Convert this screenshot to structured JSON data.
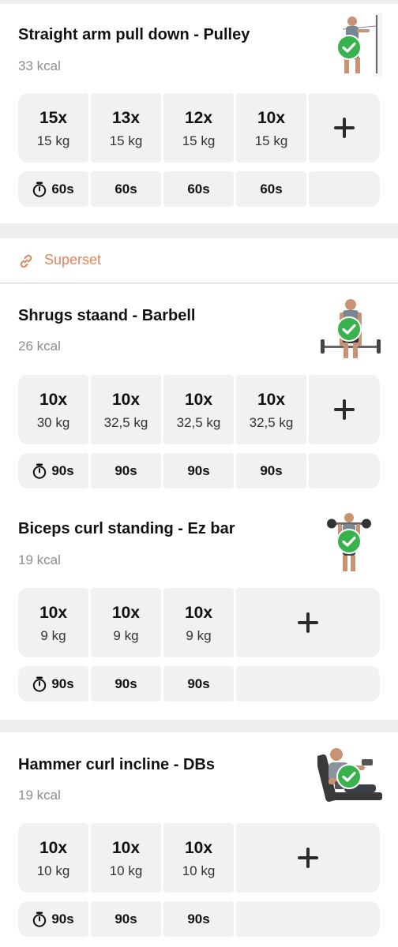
{
  "superset": {
    "label": "Superset",
    "icon": "link-icon",
    "color": "#e88258"
  },
  "exercises": [
    {
      "title": "Straight arm pull down - Pulley",
      "kcal": "33 kcal",
      "completed": true,
      "sets": [
        {
          "reps": "15x",
          "weight": "15 kg"
        },
        {
          "reps": "13x",
          "weight": "15 kg"
        },
        {
          "reps": "12x",
          "weight": "15 kg"
        },
        {
          "reps": "10x",
          "weight": "15 kg"
        }
      ],
      "rests": [
        "60s",
        "60s",
        "60s",
        "60s"
      ]
    },
    {
      "title": "Shrugs staand - Barbell",
      "kcal": "26 kcal",
      "completed": true,
      "sets": [
        {
          "reps": "10x",
          "weight": "30 kg"
        },
        {
          "reps": "10x",
          "weight": "32,5 kg"
        },
        {
          "reps": "10x",
          "weight": "32,5 kg"
        },
        {
          "reps": "10x",
          "weight": "32,5 kg"
        }
      ],
      "rests": [
        "90s",
        "90s",
        "90s",
        "90s"
      ]
    },
    {
      "title": "Biceps curl standing - Ez bar",
      "kcal": "19 kcal",
      "completed": true,
      "sets": [
        {
          "reps": "10x",
          "weight": "9 kg"
        },
        {
          "reps": "10x",
          "weight": "9 kg"
        },
        {
          "reps": "10x",
          "weight": "9 kg"
        }
      ],
      "rests": [
        "90s",
        "90s",
        "90s"
      ]
    },
    {
      "title": "Hammer curl incline - DBs",
      "kcal": "19 kcal",
      "completed": true,
      "sets": [
        {
          "reps": "10x",
          "weight": "10 kg"
        },
        {
          "reps": "10x",
          "weight": "10 kg"
        },
        {
          "reps": "10x",
          "weight": "10 kg"
        }
      ],
      "rests": [
        "90s",
        "90s",
        "90s"
      ]
    }
  ],
  "colors": {
    "check": "#37b24d",
    "cell_bg": "#f1f1f3",
    "accent": "#e88258"
  }
}
